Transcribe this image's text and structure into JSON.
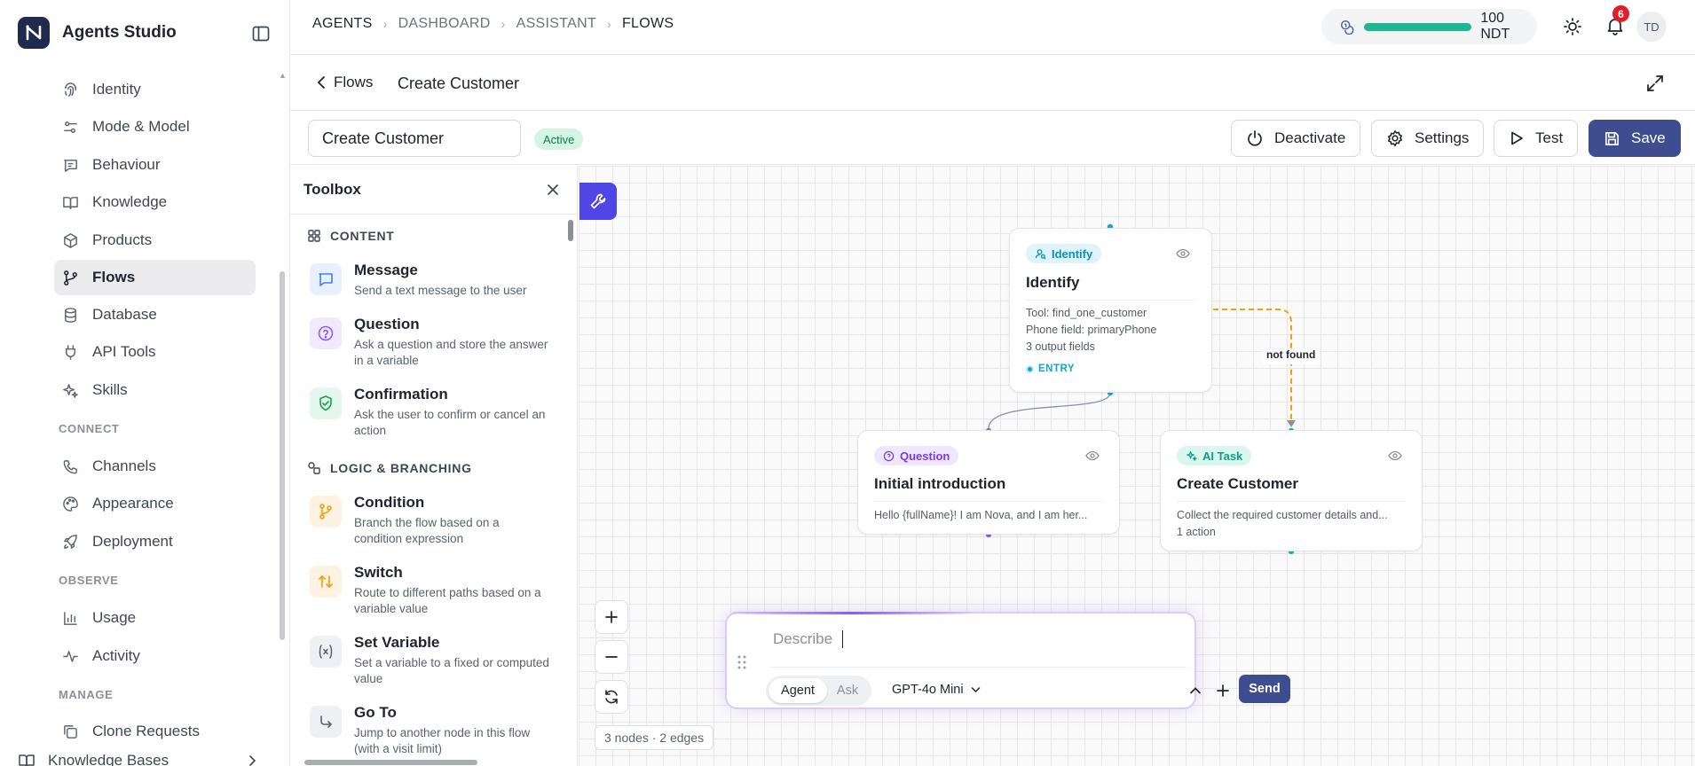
{
  "brand": {
    "name": "Agents Studio"
  },
  "sidebar": {
    "items_top": [
      {
        "label": "Identity",
        "icon": "fingerprint-icon"
      },
      {
        "label": "Mode & Model",
        "icon": "sliders-icon"
      },
      {
        "label": "Behaviour",
        "icon": "message-icon"
      },
      {
        "label": "Knowledge",
        "icon": "book-icon"
      },
      {
        "label": "Products",
        "icon": "package-icon"
      },
      {
        "label": "Flows",
        "icon": "git-branch-icon",
        "active": true
      },
      {
        "label": "Database",
        "icon": "database-icon"
      },
      {
        "label": "API Tools",
        "icon": "plug-icon"
      },
      {
        "label": "Skills",
        "icon": "sparkles-icon"
      }
    ],
    "section_connect": "CONNECT",
    "items_connect": [
      {
        "label": "Channels",
        "icon": "phone-icon"
      },
      {
        "label": "Appearance",
        "icon": "palette-icon"
      },
      {
        "label": "Deployment",
        "icon": "rocket-icon"
      }
    ],
    "section_observe": "OBSERVE",
    "items_observe": [
      {
        "label": "Usage",
        "icon": "bar-chart-icon"
      },
      {
        "label": "Activity",
        "icon": "activity-icon"
      }
    ],
    "section_manage": "MANAGE",
    "items_manage": [
      {
        "label": "Clone Requests",
        "icon": "copy-icon"
      }
    ],
    "knowledge_bases": "Knowledge Bases"
  },
  "breadcrumb": [
    "AGENTS",
    "DASHBOARD",
    "ASSISTANT",
    "FLOWS"
  ],
  "credits": {
    "label": "100 NDT",
    "fill_fraction": 1.0,
    "color": "#1db892"
  },
  "notifications": {
    "count": "6"
  },
  "user": {
    "initials": "TD"
  },
  "subheader": {
    "back_label": "Flows",
    "title": "Create Customer"
  },
  "flow": {
    "name_value": "Create Customer",
    "status": "Active",
    "deactivate": "Deactivate",
    "settings": "Settings",
    "test": "Test",
    "save": "Save"
  },
  "toolbox": {
    "title": "Toolbox",
    "section_content": "CONTENT",
    "section_logic": "LOGIC & BRANCHING",
    "items": [
      {
        "name": "Message",
        "desc": "Send a text message to the user"
      },
      {
        "name": "Question",
        "desc": "Ask a question and store the answer in a variable"
      },
      {
        "name": "Confirmation",
        "desc": "Ask the user to confirm or cancel an action"
      },
      {
        "name": "Condition",
        "desc": "Branch the flow based on a condition expression"
      },
      {
        "name": "Switch",
        "desc": "Route to different paths based on a variable value"
      },
      {
        "name": "Set Variable",
        "desc": "Set a variable to a fixed or computed value"
      },
      {
        "name": "Go To",
        "desc": "Jump to another node in this flow (with a visit limit)"
      }
    ]
  },
  "nodes": {
    "identify": {
      "badge": "Identify",
      "title": "Identify",
      "tool": "Tool: find_one_customer",
      "phone": "Phone field: primaryPhone",
      "outputs": "3 output fields",
      "entry": "ENTRY"
    },
    "question": {
      "badge": "Question",
      "title": "Initial introduction",
      "text": "Hello {fullName}! I am Nova, and I am her..."
    },
    "ai_task": {
      "badge": "AI Task",
      "title": "Create Customer",
      "text": "Collect the required customer details and...",
      "actions": "1 action"
    }
  },
  "edge_label": "not found",
  "canvas_stats": "3 nodes · 2 edges",
  "chat": {
    "placeholder": "Describe",
    "mode_agent": "Agent",
    "mode_ask": "Ask",
    "model": "GPT-4o Mini",
    "send": "Send"
  },
  "colors": {
    "accent": "#3e4d8f",
    "canvas_tool": "#4f46e5",
    "edge_fallback": "#f59e0b",
    "question": "#8b5cf6",
    "ai_task": "#14b8a6",
    "identify": "#0ea5d6"
  }
}
